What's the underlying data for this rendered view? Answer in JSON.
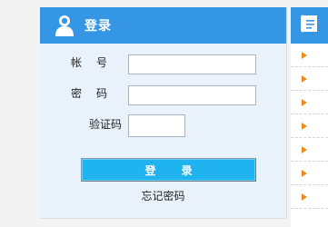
{
  "login": {
    "title": "登录",
    "account_label": "帐号",
    "password_label": "密码",
    "captcha_label": "验证码",
    "submit_label": "登录",
    "forgot_label": "忘记密码"
  },
  "colors": {
    "header_blue": "#3596e6",
    "button_cyan": "#1fb3f0",
    "panel_bg": "#e9f1fb",
    "arrow_orange": "#f08a1c"
  },
  "icons": {
    "login_header": "user-icon",
    "right_header": "document-icon",
    "list_bullet": "arrow-icon"
  }
}
